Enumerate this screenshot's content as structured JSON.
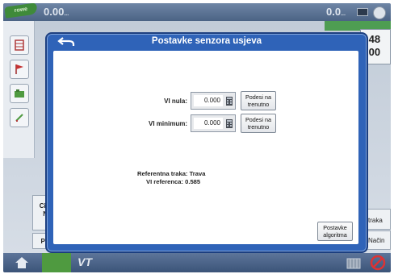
{
  "statusbar": {
    "logo_text": "rowe",
    "left_value": "0.00",
    "left_value_suffix": "...",
    "right_value": "0.0",
    "right_value_suffix": "..."
  },
  "right_panel": {
    "line1": ".48",
    "line2": ".00"
  },
  "background_labels": {
    "bottom_left_1_line1": "Cil",
    "bottom_left_1_line2": "N",
    "bottom_left_2": "Pr",
    "bottom_right_1": "traka",
    "bottom_right_2": "Način"
  },
  "bottombar": {
    "vt_label": "VT"
  },
  "modal": {
    "title": "Postavke senzora usjeva",
    "vi_nula_label": "VI nula:",
    "vi_nula_value": "0.000",
    "vi_minimum_label": "VI minimum:",
    "vi_minimum_value": "0.000",
    "set_now_label": "Podesi na\ntrenutno",
    "reference_strip": "Referentna traka: Trava",
    "vi_reference": "VI referenca: 0.585",
    "algorithm_button": "Postavke\nalgoritma"
  },
  "colors": {
    "modal_blue": "#2f63b8",
    "status_bar": "#4b6384",
    "green_accent": "#4f9a40"
  },
  "icons": [
    "back-arrow-icon",
    "keypad-icon",
    "home-icon",
    "flag-icon",
    "grid-icon",
    "edit-icon",
    "fuel-icon",
    "no-entry-icon"
  ]
}
